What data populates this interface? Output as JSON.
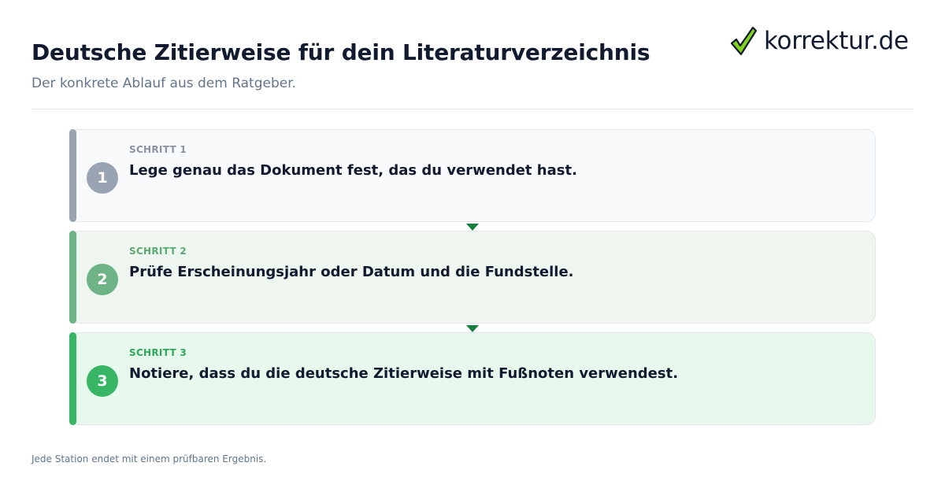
{
  "header": {
    "title": "Deutsche Zitierweise für dein Literaturverzeichnis",
    "subtitle": "Der konkrete Ablauf aus dem Ratgeber."
  },
  "logo": {
    "text": "korrektur.de",
    "icon": "checkmark-icon",
    "colors": {
      "check_fill": "#7ed321",
      "check_outline": "#111a2e"
    }
  },
  "steps": [
    {
      "number": "1",
      "label": "SCHRITT 1",
      "text": "Lege genau das Dokument fest, das du verwendet hast.",
      "accent": "#9aa3b2",
      "background": "#f8fafc"
    },
    {
      "number": "2",
      "label": "SCHRITT 2",
      "text": "Prüfe Erscheinungsjahr oder Datum und die Fundstelle.",
      "accent": "#6db385",
      "background": "#eff6f0"
    },
    {
      "number": "3",
      "label": "SCHRITT 3",
      "text": "Notiere, dass du die deutsche Zitierweise mit Fußnoten verwendest.",
      "accent": "#38b565",
      "background": "#e7f8ec"
    }
  ],
  "connector_color": "#15803d",
  "footnote": "Jede Station endet mit einem prüfbaren Ergebnis."
}
